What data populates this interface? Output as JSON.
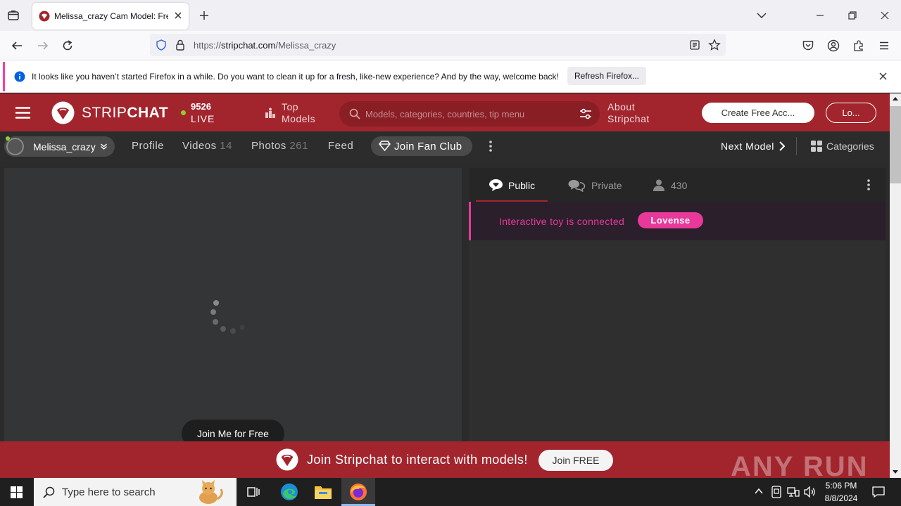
{
  "browser": {
    "tab_title": "Melissa_crazy Cam Model: Free",
    "url_prefix": "https://",
    "url_host": "stripchat.com",
    "url_path": "/Melissa_crazy",
    "notice_text": "It looks like you haven’t started Firefox in a while. Do you want to clean it up for a fresh, like-new experience? And by the way, welcome back!",
    "refresh_label": "Refresh Firefox..."
  },
  "header": {
    "logo_strip": "STRIP",
    "logo_chat": "CHAT",
    "live_count": "9526",
    "live_label": "LIVE",
    "top_models_label": "Top Models",
    "search_placeholder": "Models, categories, countries, tip menu",
    "about_label": "About Stripchat",
    "create_account_label": "Create Free Acc...",
    "login_label": "Lo..."
  },
  "model_nav": {
    "model_name": "Melissa_crazy",
    "profile_label": "Profile",
    "videos_label": "Videos",
    "videos_count": "14",
    "photos_label": "Photos",
    "photos_count": "261",
    "feed_label": "Feed",
    "fan_club_label": "Join Fan Club",
    "next_model_label": "Next Model",
    "categories_label": "Categories"
  },
  "video": {
    "join_label": "Join Me for Free"
  },
  "chat": {
    "tab_public": "Public",
    "tab_private": "Private",
    "viewer_count": "430",
    "toy_message": "Interactive toy is connected",
    "toy_brand": "Lovense"
  },
  "banner": {
    "message": "Join Stripchat to interact with models!",
    "join_label": "Join FREE",
    "watermark": "ANY RUN"
  },
  "taskbar": {
    "search_placeholder": "Type here to search",
    "time": "5:06 PM",
    "date": "8/8/2024"
  },
  "colors": {
    "brand_red": "#a2252d",
    "lovense_pink": "#e8399b",
    "live_dot": "#8ed02e"
  }
}
